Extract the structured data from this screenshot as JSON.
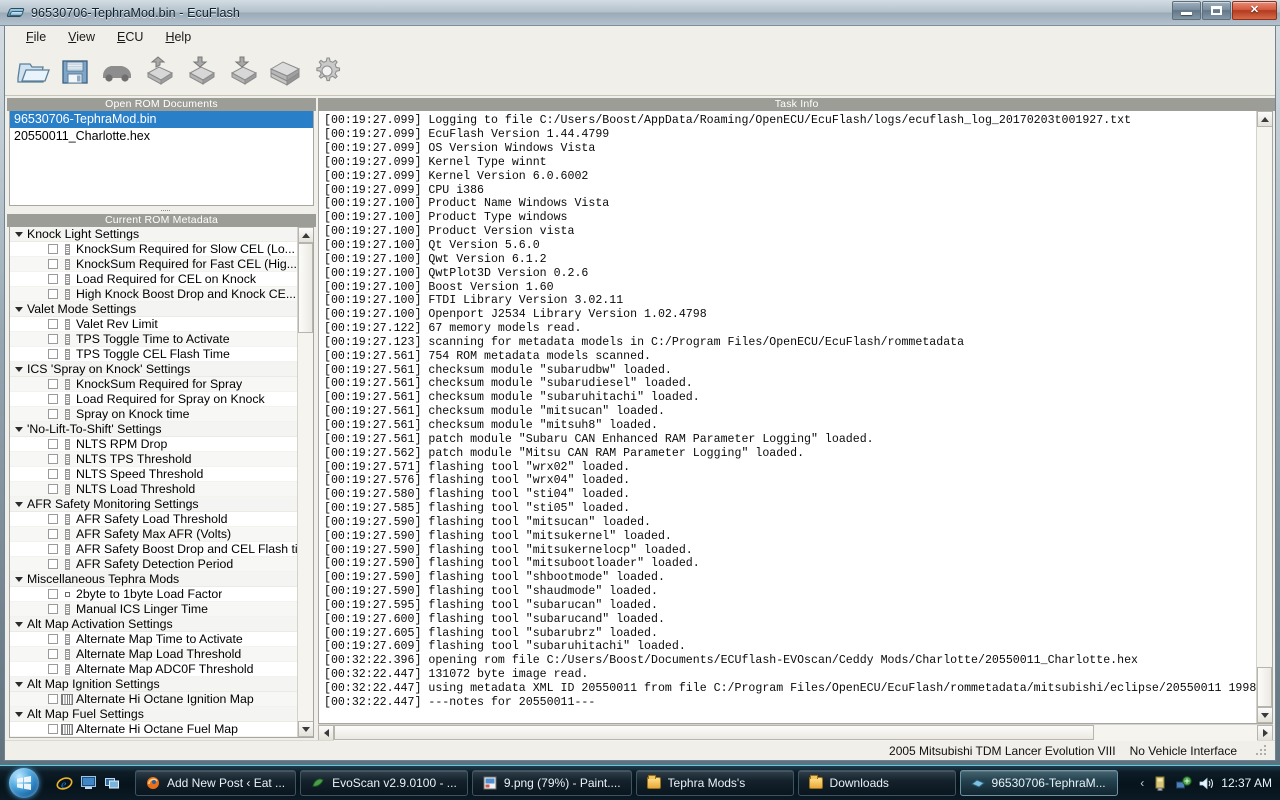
{
  "window": {
    "title": "96530706-TephraMod.bin - EcuFlash",
    "app_icon": "chip-icon",
    "buttons": {
      "minimize": "Minimize",
      "maximize": "Restore",
      "close": "Close"
    }
  },
  "menu": [
    {
      "label": "File",
      "accel": "F"
    },
    {
      "label": "View",
      "accel": "V"
    },
    {
      "label": "ECU",
      "accel": "E"
    },
    {
      "label": "Help",
      "accel": "H"
    }
  ],
  "toolbar": [
    {
      "name": "open-rom-button",
      "icon": "open-folder-icon",
      "tooltip": "Open ROM"
    },
    {
      "name": "save-rom-button",
      "icon": "floppy-save-icon",
      "tooltip": "Save ROM"
    },
    {
      "name": "vehicle-button",
      "icon": "car-icon",
      "tooltip": "Vehicle"
    },
    {
      "name": "read-ecu-button",
      "icon": "chip-up-icon",
      "tooltip": "Read ECU"
    },
    {
      "name": "write-ecu-button",
      "icon": "chip-down-icon",
      "tooltip": "Write ECU"
    },
    {
      "name": "write-ecu-alt-button",
      "icon": "chip-down-icon",
      "tooltip": "Write ECU"
    },
    {
      "name": "memory-models-button",
      "icon": "chip-stack-icon",
      "tooltip": "Memory Models"
    },
    {
      "name": "settings-button",
      "icon": "gear-icon",
      "tooltip": "Settings"
    }
  ],
  "rom_documents": {
    "header": "Open ROM Documents",
    "items": [
      {
        "label": "96530706-TephraMod.bin",
        "selected": true
      },
      {
        "label": "20550011_Charlotte.hex",
        "selected": false
      }
    ]
  },
  "metadata": {
    "header": "Current ROM Metadata",
    "groups": [
      {
        "label": "Knock Light Settings",
        "items": [
          {
            "label": "KnockSum Required for Slow CEL (Lo...",
            "icon": "axis-icon"
          },
          {
            "label": "KnockSum Required for Fast CEL (Hig...",
            "icon": "axis-icon"
          },
          {
            "label": "Load Required for CEL on Knock",
            "icon": "axis-icon"
          },
          {
            "label": "High Knock Boost Drop and Knock CE...",
            "icon": "axis-icon"
          }
        ]
      },
      {
        "label": "Valet Mode Settings",
        "items": [
          {
            "label": "Valet Rev Limit",
            "icon": "axis-icon"
          },
          {
            "label": "TPS Toggle Time to Activate",
            "icon": "axis-icon"
          },
          {
            "label": "TPS Toggle CEL Flash Time",
            "icon": "axis-icon"
          }
        ]
      },
      {
        "label": "ICS 'Spray on Knock' Settings",
        "items": [
          {
            "label": "KnockSum Required for Spray",
            "icon": "axis-icon"
          },
          {
            "label": "Load Required for Spray on Knock",
            "icon": "axis-icon"
          },
          {
            "label": "Spray on Knock time",
            "icon": "axis-icon"
          }
        ]
      },
      {
        "label": "'No-Lift-To-Shift' Settings",
        "items": [
          {
            "label": "NLTS RPM Drop",
            "icon": "axis-icon"
          },
          {
            "label": "NLTS TPS Threshold",
            "icon": "axis-icon"
          },
          {
            "label": "NLTS Speed Threshold",
            "icon": "axis-icon"
          },
          {
            "label": "NLTS Load Threshold",
            "icon": "axis-icon"
          }
        ]
      },
      {
        "label": "AFR Safety Monitoring Settings",
        "items": [
          {
            "label": "AFR Safety Load Threshold",
            "icon": "axis-icon"
          },
          {
            "label": "AFR Safety Max AFR (Volts)",
            "icon": "axis-icon"
          },
          {
            "label": "AFR Safety Boost Drop and CEL Flash ti...",
            "icon": "axis-icon"
          },
          {
            "label": "AFR Safety Detection Period",
            "icon": "axis-icon"
          }
        ]
      },
      {
        "label": "Miscellaneous Tephra Mods",
        "items": [
          {
            "label": "2byte to 1byte Load Factor",
            "icon": "scalar-icon"
          },
          {
            "label": "Manual ICS Linger Time",
            "icon": "axis-icon"
          }
        ]
      },
      {
        "label": "Alt Map Activation Settings",
        "items": [
          {
            "label": "Alternate Map Time to Activate",
            "icon": "axis-icon"
          },
          {
            "label": "Alternate Map Load Threshold",
            "icon": "axis-icon"
          },
          {
            "label": "Alternate Map ADC0F Threshold",
            "icon": "axis-icon"
          }
        ]
      },
      {
        "label": "Alt Map Ignition Settings",
        "items": [
          {
            "label": "Alternate Hi Octane Ignition Map",
            "icon": "table-icon"
          }
        ]
      },
      {
        "label": "Alt Map Fuel Settings",
        "items": [
          {
            "label": "Alternate Hi Octane Fuel Map",
            "icon": "table-icon"
          }
        ]
      }
    ]
  },
  "task_info": {
    "header": "Task Info",
    "lines": [
      "[00:19:27.099] Logging to file C:/Users/Boost/AppData/Roaming/OpenECU/EcuFlash/logs/ecuflash_log_20170203t001927.txt",
      "[00:19:27.099] EcuFlash Version 1.44.4799",
      "[00:19:27.099] OS Version Windows Vista",
      "[00:19:27.099] Kernel Type winnt",
      "[00:19:27.099] Kernel Version 6.0.6002",
      "[00:19:27.099] CPU i386",
      "[00:19:27.100] Product Name Windows Vista",
      "[00:19:27.100] Product Type windows",
      "[00:19:27.100] Product Version vista",
      "[00:19:27.100] Qt Version 5.6.0",
      "[00:19:27.100] Qwt Version 6.1.2",
      "[00:19:27.100] QwtPlot3D Version 0.2.6",
      "[00:19:27.100] Boost Version 1.60",
      "[00:19:27.100] FTDI Library Version 3.02.11",
      "[00:19:27.100] Openport J2534 Library Version 1.02.4798",
      "[00:19:27.122] 67 memory models read.",
      "[00:19:27.123] scanning for metadata models in C:/Program Files/OpenECU/EcuFlash/rommetadata",
      "[00:19:27.561] 754 ROM metadata models scanned.",
      "[00:19:27.561] checksum module \"subarudbw\" loaded.",
      "[00:19:27.561] checksum module \"subarudiesel\" loaded.",
      "[00:19:27.561] checksum module \"subaruhitachi\" loaded.",
      "[00:19:27.561] checksum module \"mitsucan\" loaded.",
      "[00:19:27.561] checksum module \"mitsuh8\" loaded.",
      "[00:19:27.561] patch module \"Subaru CAN Enhanced RAM Parameter Logging\" loaded.",
      "[00:19:27.562] patch module \"Mitsu CAN RAM Parameter Logging\" loaded.",
      "[00:19:27.571] flashing tool \"wrx02\" loaded.",
      "[00:19:27.576] flashing tool \"wrx04\" loaded.",
      "[00:19:27.580] flashing tool \"sti04\" loaded.",
      "[00:19:27.585] flashing tool \"sti05\" loaded.",
      "[00:19:27.590] flashing tool \"mitsucan\" loaded.",
      "[00:19:27.590] flashing tool \"mitsukernel\" loaded.",
      "[00:19:27.590] flashing tool \"mitsukernelocp\" loaded.",
      "[00:19:27.590] flashing tool \"mitsubootloader\" loaded.",
      "[00:19:27.590] flashing tool \"shbootmode\" loaded.",
      "[00:19:27.590] flashing tool \"shaudmode\" loaded.",
      "[00:19:27.595] flashing tool \"subarucan\" loaded.",
      "[00:19:27.600] flashing tool \"subarucand\" loaded.",
      "[00:19:27.605] flashing tool \"subarubrz\" loaded.",
      "[00:19:27.609] flashing tool \"subaruhitachi\" loaded.",
      "[00:32:22.396] opening rom file C:/Users/Boost/Documents/ECUflash-EVOscan/Ceddy Mods/Charlotte/20550011_Charlotte.hex",
      "[00:32:22.447] 131072 byte image read.",
      "[00:32:22.447] using metadata XML ID 20550011 from file C:/Program Files/OpenECU/EcuFlash/rommetadata/mitsubishi/eclipse/20550011 1998",
      "[00:32:22.447] ---notes for 20550011---"
    ]
  },
  "statusbar": {
    "vehicle": "2005 Mitsubishi TDM Lancer Evolution VIII",
    "interface": "No Vehicle Interface"
  },
  "taskbar": {
    "start_label": "Start",
    "quick_launch": [
      {
        "name": "internet-explorer-icon",
        "label": "Internet Explorer"
      },
      {
        "name": "show-desktop-icon",
        "label": "Show Desktop"
      },
      {
        "name": "switch-window-icon",
        "label": "Switch between windows"
      }
    ],
    "tasks": [
      {
        "label": "Add New Post ‹ Eat ...",
        "icon": "firefox-icon",
        "active": false
      },
      {
        "label": "EvoScan v2.9.0100 - ...",
        "icon": "evoscan-icon",
        "active": false
      },
      {
        "label": "9.png (79%) - Paint....",
        "icon": "paint-icon",
        "active": false
      },
      {
        "label": "Tephra Mods's",
        "icon": "folder-icon",
        "active": false
      },
      {
        "label": "Downloads",
        "icon": "folder-icon",
        "active": false
      },
      {
        "label": "96530706-TephraM...",
        "icon": "chip-icon",
        "active": true
      }
    ],
    "tray": {
      "chevron": "‹",
      "icons": [
        {
          "name": "flash-drive-icon"
        },
        {
          "name": "network-icon"
        },
        {
          "name": "volume-icon"
        }
      ],
      "clock": "12:37 AM"
    }
  },
  "colors": {
    "selection": "#2a7fc9",
    "panel_header_bg": "#9d9d97",
    "window_bg": "#f0efe9",
    "taskbar_accent": "#4fd2e8"
  }
}
